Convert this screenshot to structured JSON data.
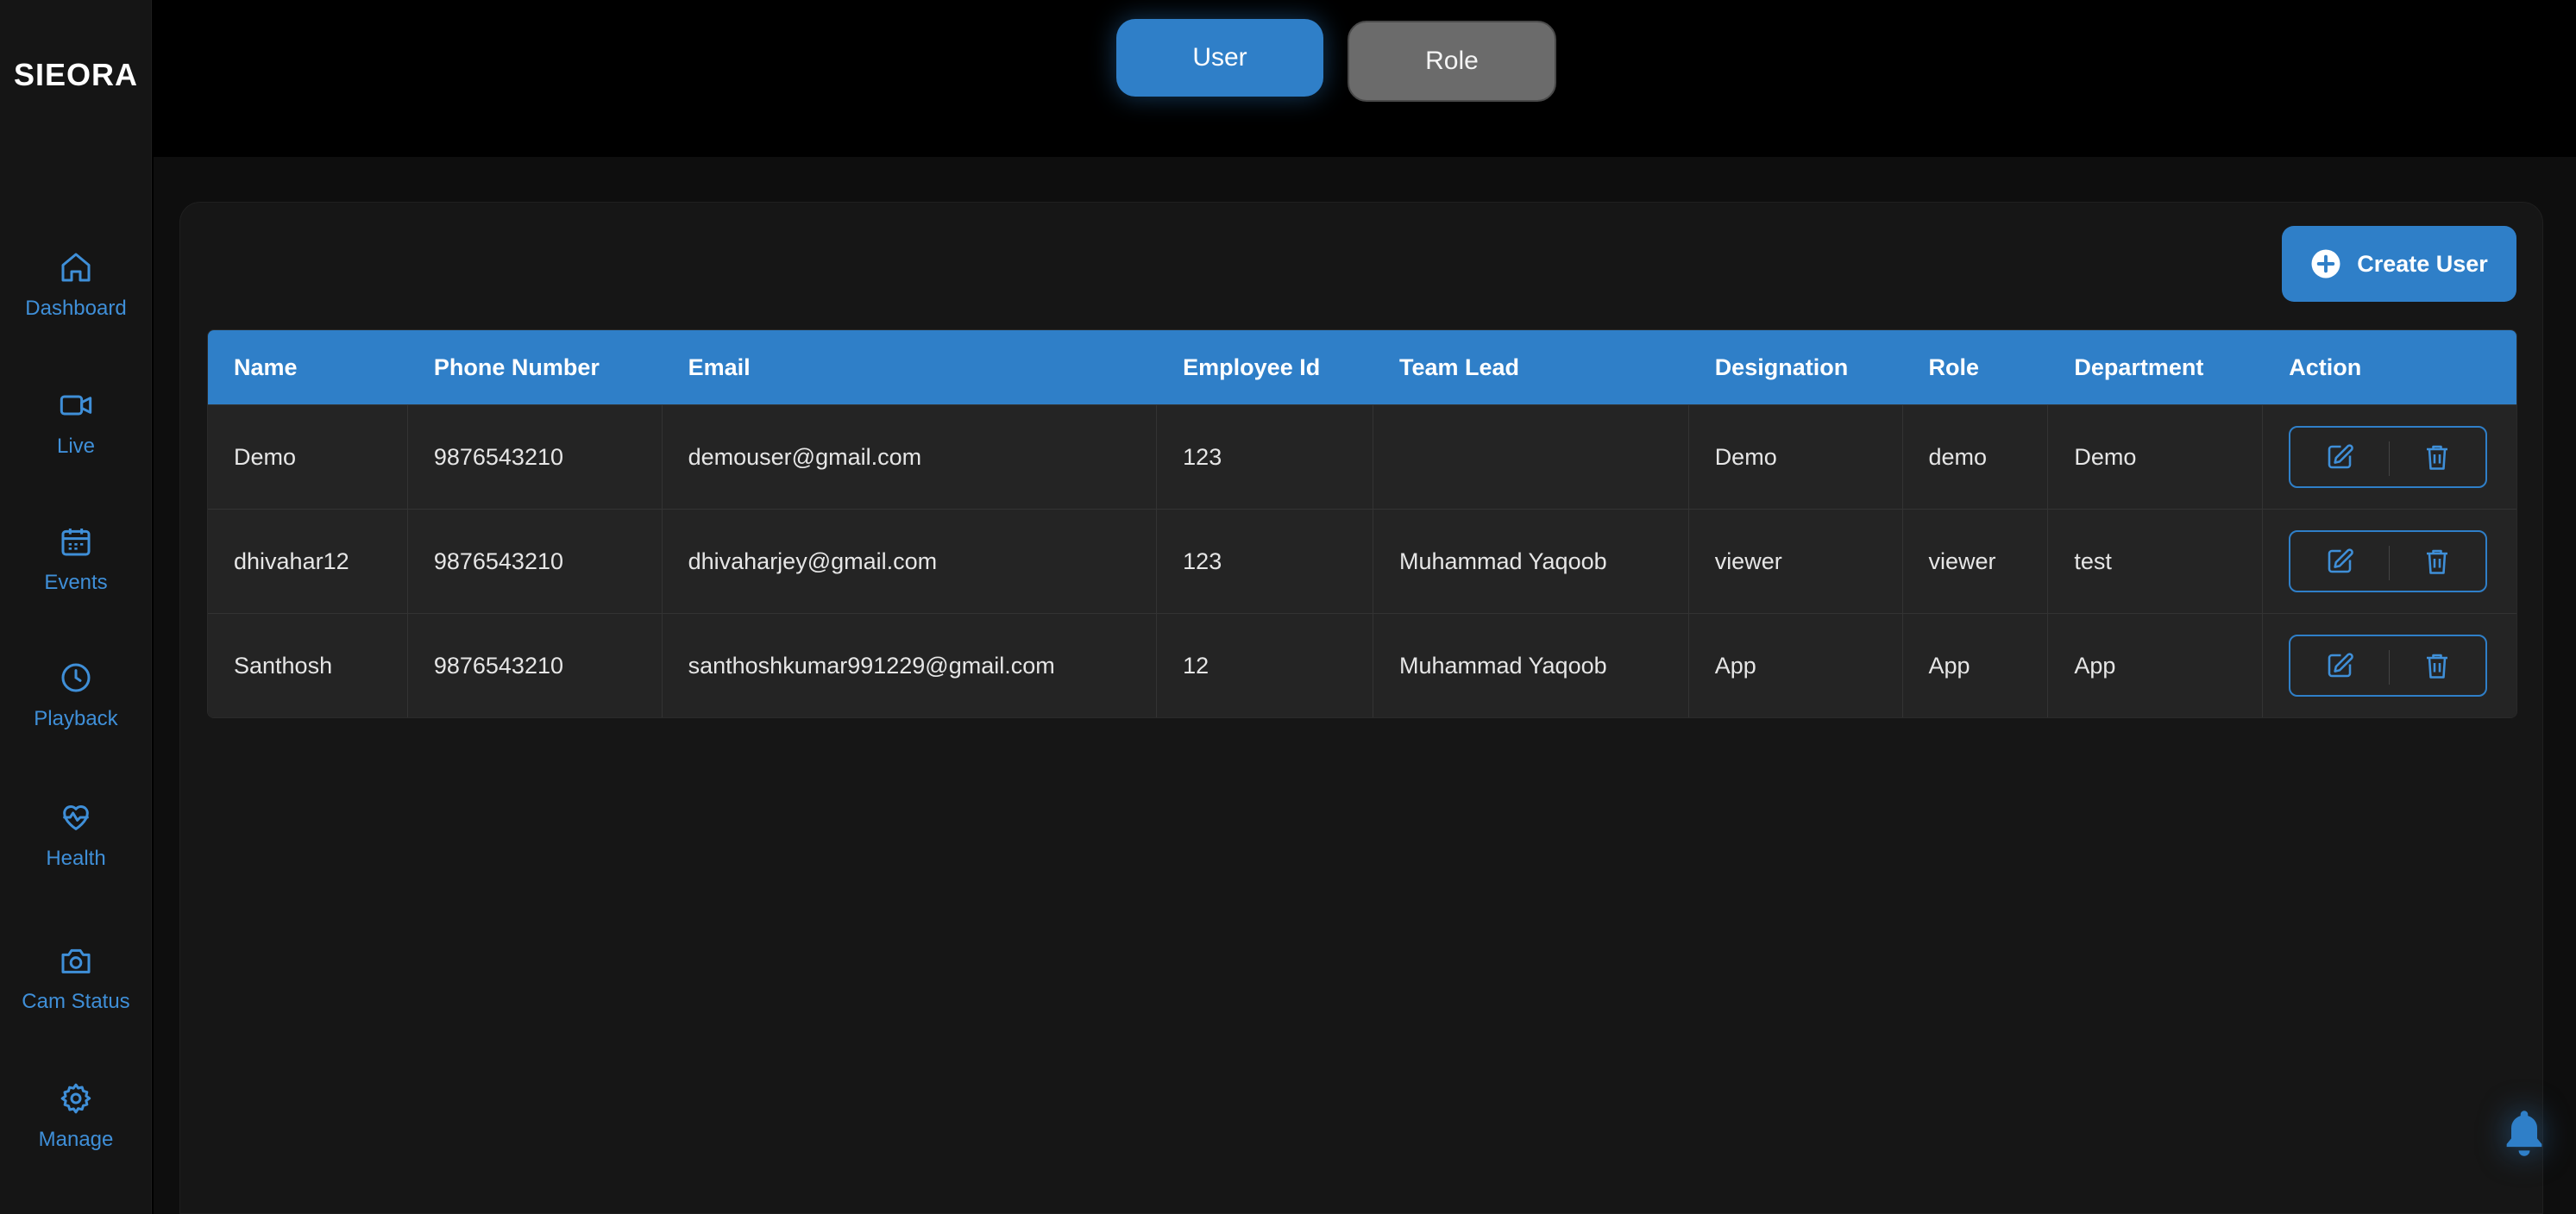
{
  "app": {
    "brand": "SIEORA"
  },
  "sidebar": {
    "items": [
      {
        "label": "Dashboard",
        "icon": "home-icon"
      },
      {
        "label": "Live",
        "icon": "video-icon"
      },
      {
        "label": "Events",
        "icon": "calendar-icon"
      },
      {
        "label": "Playback",
        "icon": "clock-icon"
      },
      {
        "label": "Health",
        "icon": "heart-pulse-icon"
      },
      {
        "label": "Cam Status",
        "icon": "camera-icon"
      },
      {
        "label": "Manage",
        "icon": "gear-icon"
      }
    ]
  },
  "tabs": {
    "user": "User",
    "role": "Role",
    "active": "User"
  },
  "toolbar": {
    "create_label": "Create User"
  },
  "table": {
    "headers": [
      "Name",
      "Phone Number",
      "Email",
      "Employee Id",
      "Team Lead",
      "Designation",
      "Role",
      "Department",
      "Action"
    ],
    "rows": [
      [
        "Demo",
        "9876543210",
        "demouser@gmail.com",
        "123",
        "",
        "Demo",
        "demo",
        "Demo"
      ],
      [
        "dhivahar12",
        "9876543210",
        "dhivaharjey@gmail.com",
        "123",
        "Muhammad Yaqoob",
        "viewer",
        "viewer",
        "test"
      ],
      [
        "Santhosh",
        "9876543210",
        "santhoshkumar991229@gmail.com",
        "12",
        "Muhammad Yaqoob",
        "App",
        "App",
        "App"
      ]
    ]
  },
  "colors": {
    "accent": "#2f7fc8",
    "sidebar_text": "#3f8fd8",
    "inactive_tab": "#6b6b6b",
    "row_bg": "#242424",
    "background": "#000000"
  }
}
